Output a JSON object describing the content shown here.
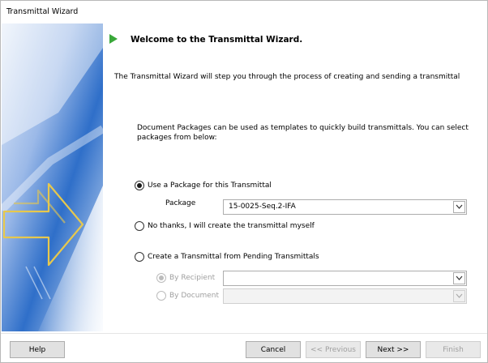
{
  "window": {
    "title": "Transmittal Wizard"
  },
  "header": {
    "title": "Welcome to the Transmittal Wizard."
  },
  "intro_text": "The Transmittal Wizard will step you through the process of creating and sending a transmittal",
  "packages_text": "Document Packages can be used as templates to quickly build transmittals.  You can select packages from below:",
  "options": {
    "use_package": {
      "label": "Use a Package for this Transmittal",
      "checked": true
    },
    "package_label": "Package",
    "package_value": "15-0025-Seq.2-IFA",
    "no_thanks": {
      "label": "No thanks, I will create the transmittal myself",
      "checked": false
    },
    "pending": {
      "label": "Create a Transmittal from Pending Transmittals",
      "checked": false
    },
    "by_recipient": {
      "label": "By Recipient",
      "checked": true,
      "enabled": false,
      "value": ""
    },
    "by_document": {
      "label": "By Document",
      "checked": false,
      "enabled": false,
      "value": ""
    }
  },
  "buttons": {
    "help": "Help",
    "cancel": "Cancel",
    "previous": "<< Previous",
    "next": "Next >>",
    "finish": "Finish"
  },
  "colors": {
    "accent_arrow": "#3aa83a",
    "panel_blue": "#2f6fc9",
    "panel_arrow": "#e7c84d"
  }
}
